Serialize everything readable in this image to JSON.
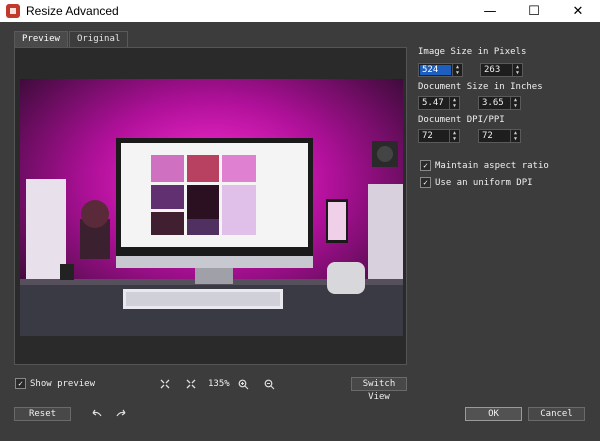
{
  "window": {
    "title": "Resize Advanced",
    "controls": [
      "—",
      "☐",
      "✕"
    ]
  },
  "tabs": [
    {
      "label": "Preview",
      "active": true
    },
    {
      "label": "Original",
      "active": false
    }
  ],
  "sidebar": {
    "pixels_label": "Image Size in Pixels",
    "pixels_width": "524",
    "pixels_height": "263",
    "inches_label": "Document Size in Inches",
    "inches_width": "5.47",
    "inches_height": "3.65",
    "dpi_label": "Document DPI/PPI",
    "dpi_x": "72",
    "dpi_y": "72",
    "maintain_aspect": {
      "label": "Maintain aspect ratio",
      "checked": true
    },
    "uniform_dpi": {
      "label": "Use an uniform DPI",
      "checked": true
    }
  },
  "toolbar": {
    "show_preview": {
      "label": "Show preview",
      "checked": true
    },
    "zoom_level": "135%",
    "switch_view_label": "Switch View"
  },
  "footer": {
    "reset_label": "Reset",
    "ok_label": "OK",
    "cancel_label": "Cancel"
  },
  "icons": {
    "fit": "fit-to-window-icon",
    "actual": "actual-size-icon",
    "zoom_in": "zoom-in-icon",
    "zoom_out": "zoom-out-icon",
    "undo": "undo-icon",
    "redo": "redo-icon"
  },
  "colors": {
    "accent": "#1d5fbf",
    "background": "#3c3c3c",
    "titlebar": "#ffffff",
    "app_icon": "#c0392b"
  }
}
